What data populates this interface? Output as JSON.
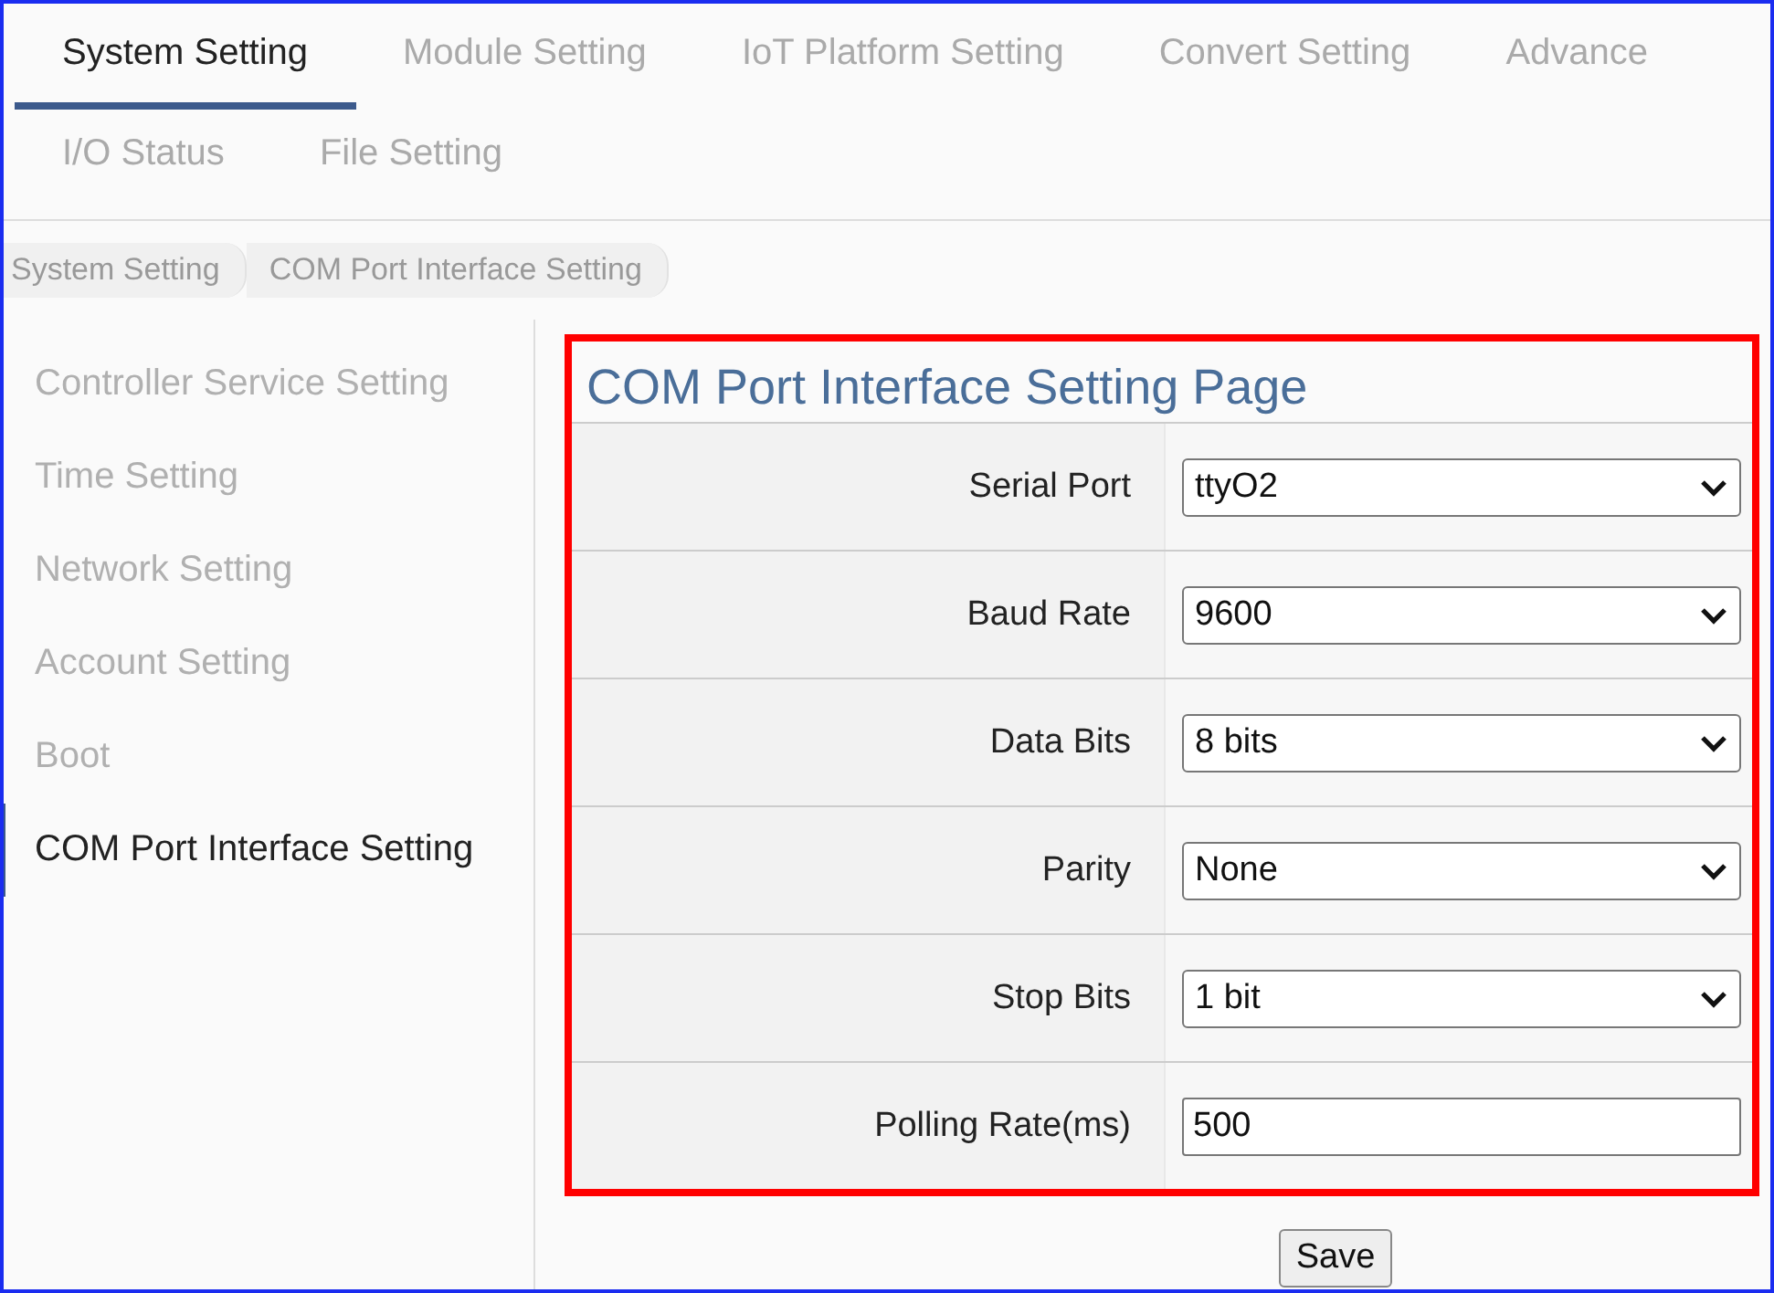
{
  "tabs": [
    {
      "label": "System Setting",
      "selected": true
    },
    {
      "label": "Module Setting",
      "selected": false
    },
    {
      "label": "IoT Platform Setting",
      "selected": false
    },
    {
      "label": "Convert Setting",
      "selected": false
    },
    {
      "label": "Advance",
      "selected": false
    },
    {
      "label": "I/O Status",
      "selected": false
    },
    {
      "label": "File Setting",
      "selected": false
    }
  ],
  "breadcrumb": [
    "System Setting",
    "COM Port Interface Setting"
  ],
  "sidebar": {
    "items": [
      {
        "label": "Controller Service Setting",
        "selected": false
      },
      {
        "label": "Time Setting",
        "selected": false
      },
      {
        "label": "Network Setting",
        "selected": false
      },
      {
        "label": "Account Setting",
        "selected": false
      },
      {
        "label": "Boot",
        "selected": false
      },
      {
        "label": "COM Port Interface Setting",
        "selected": true
      }
    ]
  },
  "form": {
    "title": "COM Port Interface Setting Page",
    "highlighted": true,
    "rows": [
      {
        "label": "Serial Port",
        "kind": "select",
        "value": "ttyO2"
      },
      {
        "label": "Baud Rate",
        "kind": "select",
        "value": "9600"
      },
      {
        "label": "Data Bits",
        "kind": "select",
        "value": "8 bits"
      },
      {
        "label": "Parity",
        "kind": "select",
        "value": "None"
      },
      {
        "label": "Stop Bits",
        "kind": "select",
        "value": "1 bit"
      },
      {
        "label": "Polling Rate(ms)",
        "kind": "input",
        "value": "500"
      }
    ],
    "save_button": "Save"
  }
}
